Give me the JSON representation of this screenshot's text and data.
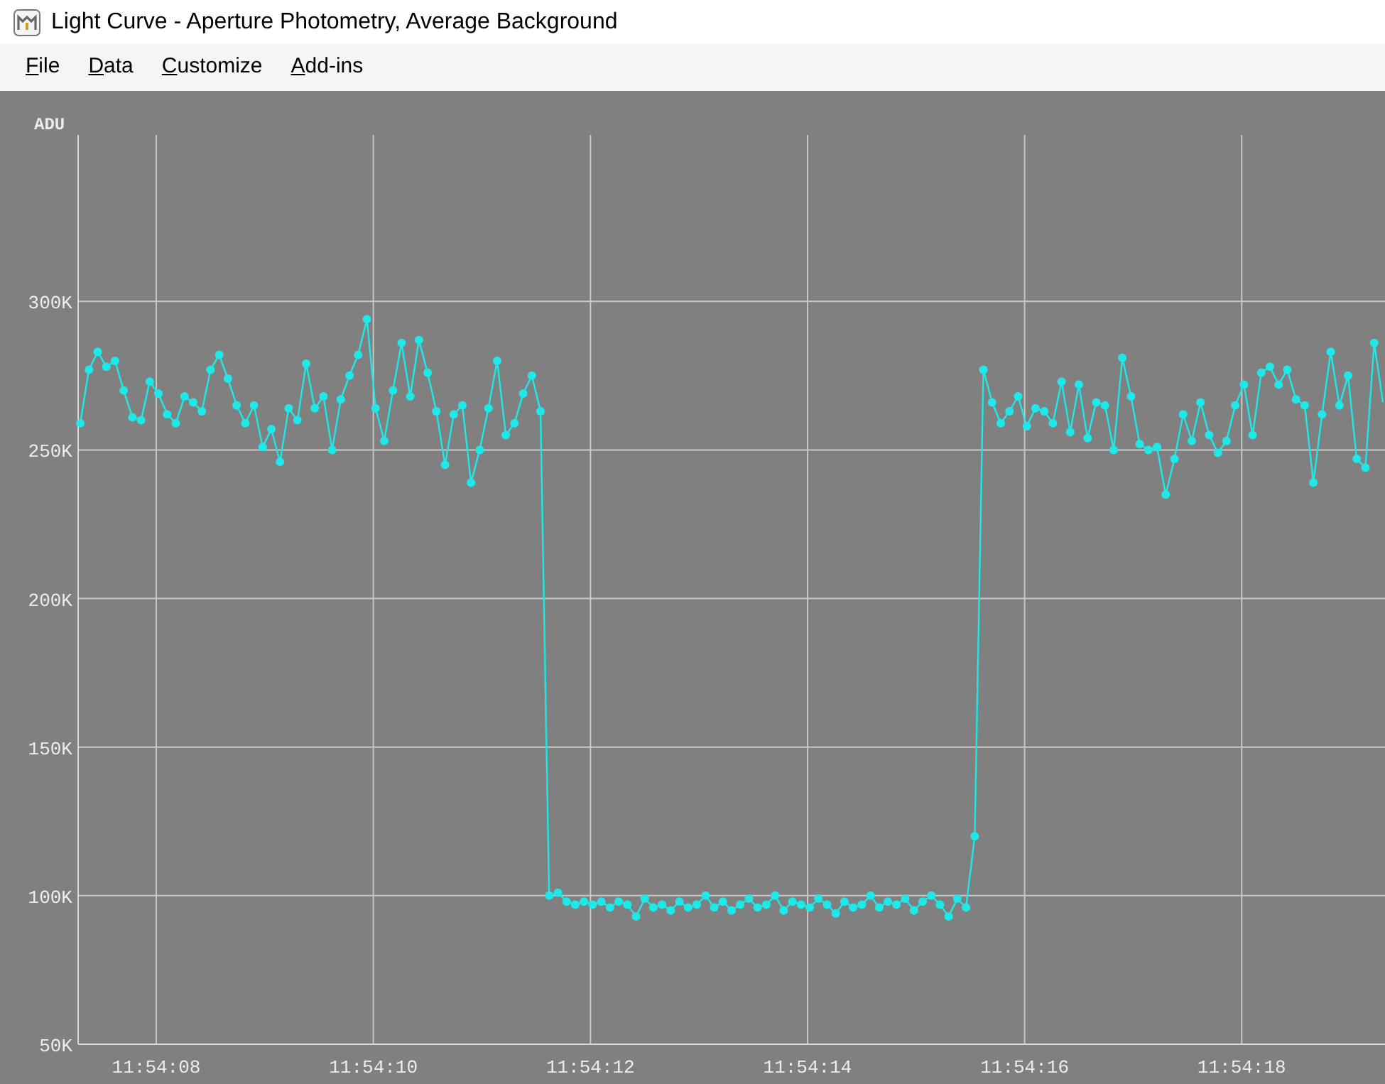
{
  "window": {
    "title": "Light Curve - Aperture Photometry, Average Background"
  },
  "menu": [
    "File",
    "Data",
    "Customize",
    "Add-ins"
  ],
  "chart": {
    "chart_data": {
      "type": "line",
      "ylabel": "ADU",
      "x": [
        42847.3,
        42847.38,
        42847.46,
        42847.54,
        42847.62,
        42847.7,
        42847.78,
        42847.86,
        42847.94,
        42848.02,
        42848.1,
        42848.18,
        42848.26,
        42848.34,
        42848.42,
        42848.5,
        42848.58,
        42848.66,
        42848.74,
        42848.82,
        42848.9,
        42848.98,
        42849.06,
        42849.14,
        42849.22,
        42849.3,
        42849.38,
        42849.46,
        42849.54,
        42849.62,
        42849.7,
        42849.78,
        42849.86,
        42849.94,
        42850.02,
        42850.1,
        42850.18,
        42850.26,
        42850.34,
        42850.42,
        42850.5,
        42850.58,
        42850.66,
        42850.74,
        42850.82,
        42850.9,
        42850.98,
        42851.06,
        42851.14,
        42851.22,
        42851.3,
        42851.38,
        42851.46,
        42851.54,
        42851.62,
        42851.7,
        42851.78,
        42851.86,
        42851.94,
        42852.02,
        42852.1,
        42852.18,
        42852.26,
        42852.34,
        42852.42,
        42852.5,
        42852.58,
        42852.66,
        42852.74,
        42852.82,
        42852.9,
        42852.98,
        42853.06,
        42853.14,
        42853.22,
        42853.3,
        42853.38,
        42853.46,
        42853.54,
        42853.62,
        42853.7,
        42853.78,
        42853.86,
        42853.94,
        42854.02,
        42854.1,
        42854.18,
        42854.26,
        42854.34,
        42854.42,
        42854.5,
        42854.58,
        42854.66,
        42854.74,
        42854.82,
        42854.9,
        42854.98,
        42855.06,
        42855.14,
        42855.22,
        42855.3,
        42855.38,
        42855.46,
        42855.54,
        42855.62,
        42855.7,
        42855.78,
        42855.86,
        42855.94,
        42856.02,
        42856.1,
        42856.18,
        42856.26,
        42856.34,
        42856.42,
        42856.5,
        42856.58,
        42856.66,
        42856.74,
        42856.82,
        42856.9,
        42856.98,
        42857.06,
        42857.14,
        42857.22,
        42857.3,
        42857.38,
        42857.46,
        42857.54,
        42857.62,
        42857.7,
        42857.78,
        42857.86,
        42857.94,
        42858.02,
        42858.1,
        42858.18,
        42858.26,
        42858.34,
        42858.42,
        42858.5,
        42858.58,
        42858.66,
        42858.74,
        42858.82,
        42858.9,
        42858.98,
        42859.06,
        42859.14,
        42859.22,
        42859.3
      ],
      "grid": true,
      "series": [
        {
          "color": "#1ee8e8",
          "marker": "circle",
          "values": [
            259,
            277,
            283,
            278,
            280,
            270,
            261,
            260,
            273,
            269,
            262,
            259,
            268,
            266,
            263,
            277,
            282,
            274,
            265,
            259,
            265,
            251,
            257,
            246,
            264,
            260,
            279,
            264,
            268,
            250,
            267,
            275,
            282,
            294,
            264,
            253,
            270,
            286,
            268,
            287,
            276,
            263,
            245,
            262,
            265,
            239,
            250,
            264,
            280,
            255,
            259,
            269,
            275,
            263,
            100,
            101,
            98,
            97,
            98,
            97,
            98,
            96,
            98,
            97,
            93,
            99,
            96,
            97,
            95,
            98,
            96,
            97,
            100,
            96,
            98,
            95,
            97,
            99,
            96,
            97,
            100,
            95,
            98,
            97,
            96,
            99,
            97,
            94,
            98,
            96,
            97,
            100,
            96,
            98,
            97,
            99,
            95,
            98,
            100,
            97,
            93,
            99,
            96,
            120,
            277,
            266,
            259,
            263,
            268,
            258,
            264,
            263,
            259,
            273,
            256,
            272,
            254,
            266,
            265,
            250,
            281,
            268,
            252,
            250,
            251,
            235,
            247,
            262,
            253,
            266,
            255,
            249,
            253,
            265,
            272,
            255,
            276,
            278,
            272,
            277,
            267,
            265,
            239,
            262,
            283,
            265,
            275,
            247,
            244,
            286,
            266
          ]
        }
      ],
      "xlim": [
        42847.28,
        42859.32
      ],
      "ylim": [
        50,
        356
      ],
      "xticks": [
        {
          "value": 42848,
          "label": "11:54:08"
        },
        {
          "value": 42850,
          "label": "11:54:10"
        },
        {
          "value": 42852,
          "label": "11:54:12"
        },
        {
          "value": 42854,
          "label": "11:54:14"
        },
        {
          "value": 42856,
          "label": "11:54:16"
        },
        {
          "value": 42858,
          "label": "11:54:18"
        }
      ],
      "yticks": [
        {
          "value": 50,
          "label": "50K"
        },
        {
          "value": 100,
          "label": "100K"
        },
        {
          "value": 150,
          "label": "150K"
        },
        {
          "value": 200,
          "label": "200K"
        },
        {
          "value": 250,
          "label": "250K"
        },
        {
          "value": 300,
          "label": "300K"
        }
      ]
    }
  }
}
